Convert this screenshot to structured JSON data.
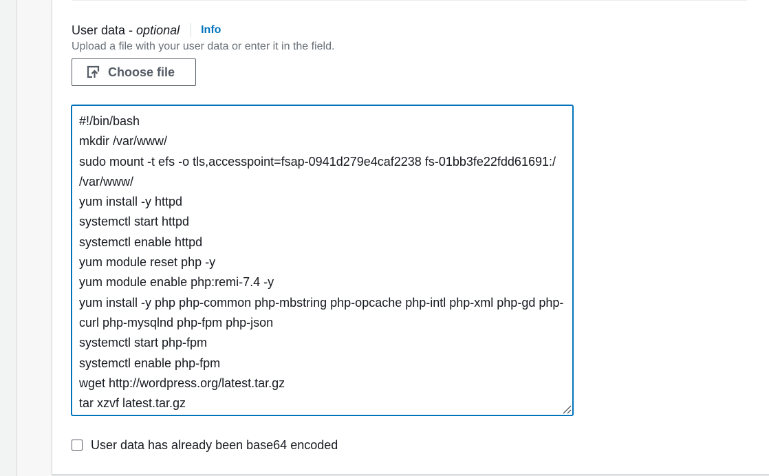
{
  "user_data": {
    "label": "User data -",
    "optional": "optional",
    "info_link": "Info",
    "description": "Upload a file with your user data or enter it in the field.",
    "choose_file_label": "Choose file",
    "script_lines": [
      "#!/bin/bash",
      "mkdir /var/www/",
      "sudo mount -t efs -o tls,accesspoint=fsap-0941d279e4caf2238 fs-01bb3fe22fdd61691:/ /var/www/",
      "yum install -y httpd",
      "systemctl start httpd",
      "systemctl enable httpd",
      "yum module reset php -y",
      "yum module enable php:remi-7.4 -y",
      "yum install -y php php-common php-mbstring php-opcache php-intl php-xml php-gd php-curl php-mysqlnd php-fpm php-json",
      "systemctl start php-fpm",
      "systemctl enable php-fpm",
      "wget http://wordpress.org/latest.tar.gz",
      "tar xzvf latest.tar.gz"
    ],
    "base64_checkbox_label": "User data has already been base64 encoded",
    "base64_checked": false
  },
  "colors": {
    "accent": "#0073bb",
    "text": "#16191f",
    "muted": "#687078",
    "border": "#545b64"
  }
}
